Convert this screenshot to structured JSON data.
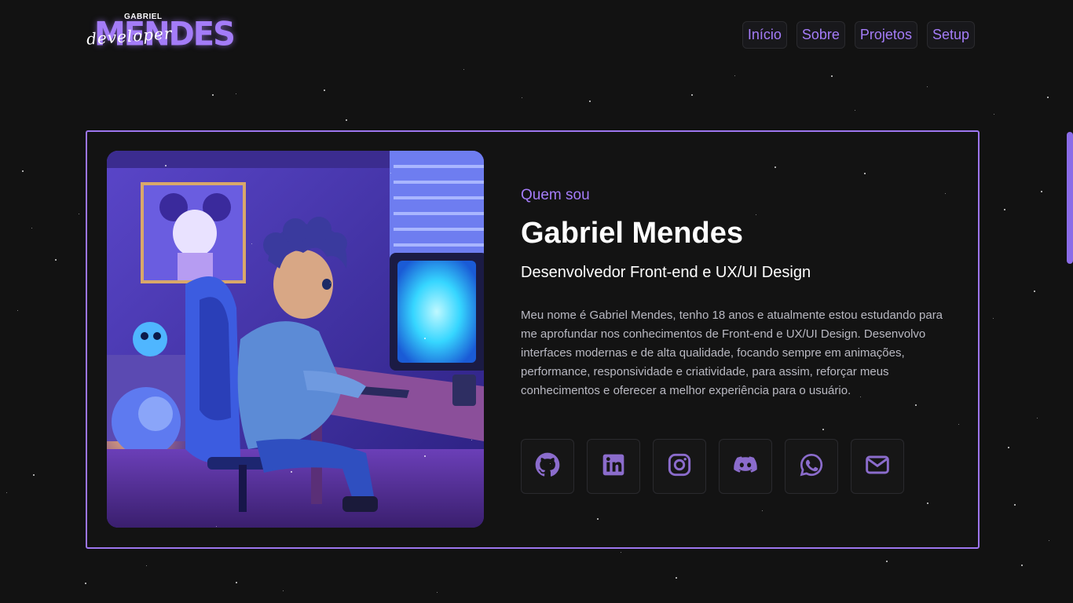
{
  "logo": {
    "top_text": "GABRIEL",
    "main_text": "MENDES",
    "script_text": "developer"
  },
  "nav": {
    "items": [
      {
        "label": "Início"
      },
      {
        "label": "Sobre"
      },
      {
        "label": "Projetos"
      },
      {
        "label": "Setup"
      }
    ]
  },
  "about": {
    "kicker": "Quem sou",
    "name": "Gabriel Mendes",
    "role": "Desenvolvedor Front-end e UX/UI Design",
    "bio": "Meu nome é Gabriel Mendes, tenho 18 anos e atualmente estou estudando para me aprofundar nos conhecimentos de Front-end e UX/UI Design. Desenvolvo interfaces modernas e de alta qualidade, focando sempre em animações, performance, responsividade e criatividade, para assim, reforçar meus conhecimentos e oferecer a melhor experiência para o usuário."
  },
  "socials": [
    {
      "icon": "github-icon"
    },
    {
      "icon": "linkedin-icon"
    },
    {
      "icon": "instagram-icon"
    },
    {
      "icon": "discord-icon"
    },
    {
      "icon": "whatsapp-icon"
    },
    {
      "icon": "email-icon"
    }
  ],
  "colors": {
    "accent": "#a47cf8",
    "border": "#9d76ef",
    "background": "#121212",
    "icon": "#8b6ccc"
  }
}
